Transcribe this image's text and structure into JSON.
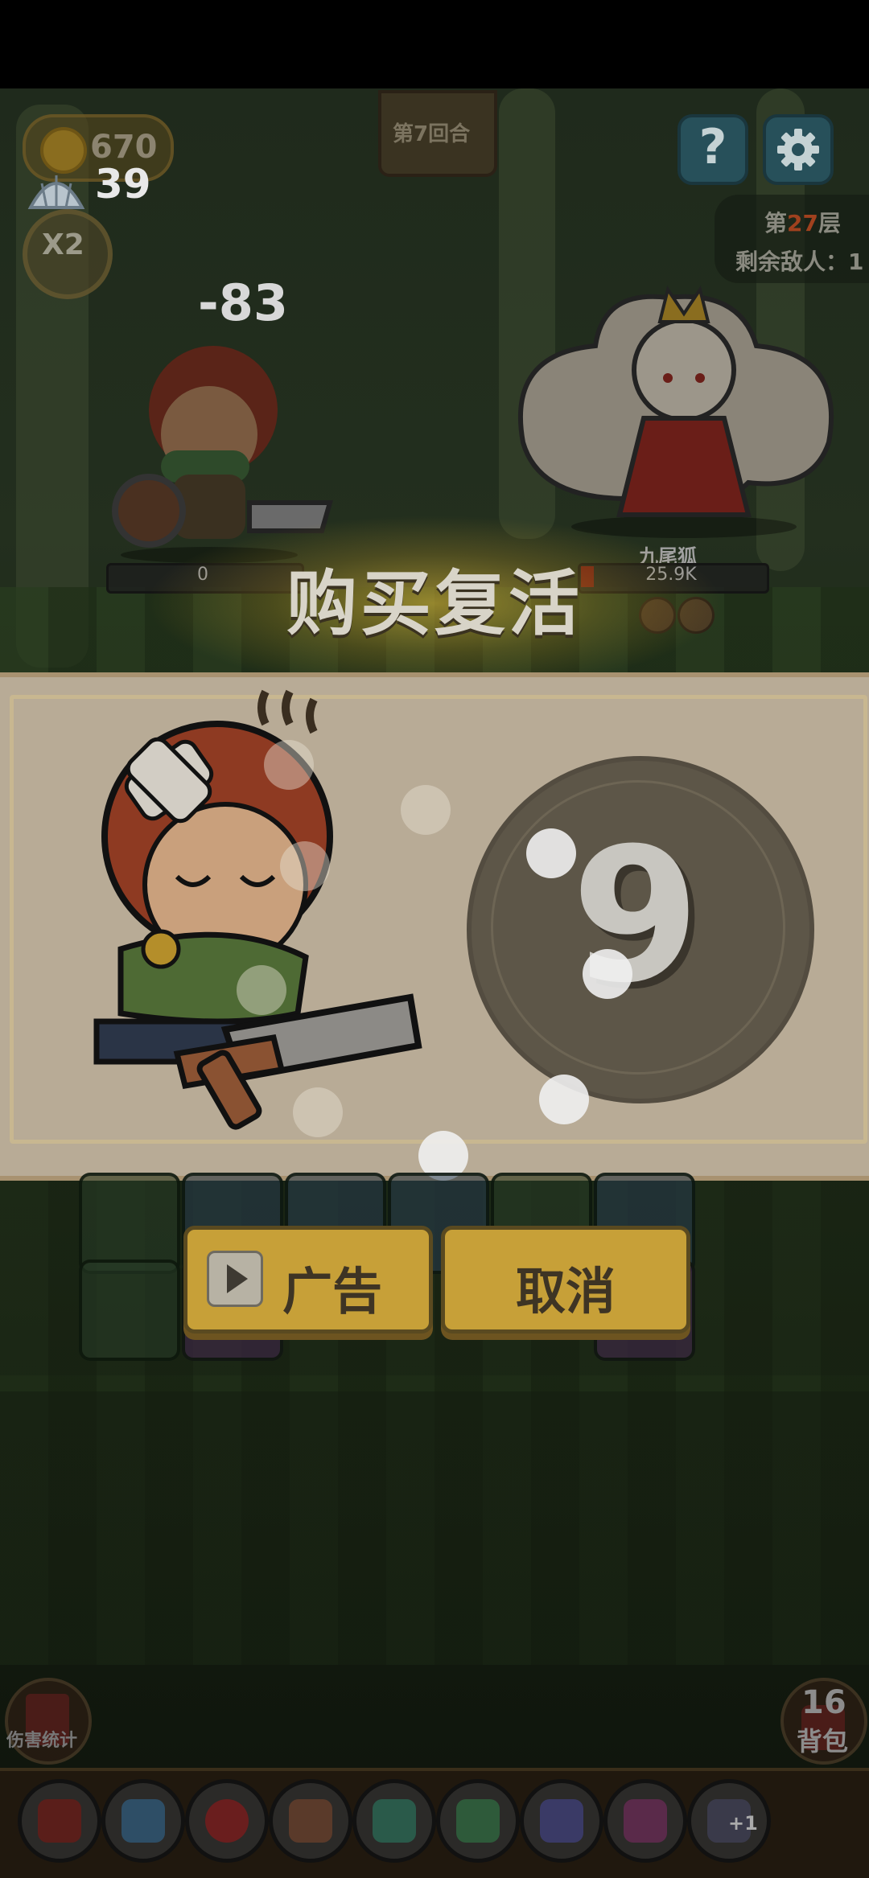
{
  "hud": {
    "coins": "670",
    "shells": "39",
    "speed": "X2",
    "round": "第7回合",
    "help_label": "?",
    "floor_prefix": "第",
    "floor_number": "27",
    "floor_suffix": "层",
    "enemies_remaining": "剩余敌人：1"
  },
  "battle": {
    "damage_popup": "-83",
    "hero_hp": "0",
    "enemy_name": "九尾狐",
    "enemy_hp": "25.9K"
  },
  "revive": {
    "title": "购买复活",
    "countdown": "9",
    "ad_button": "广告",
    "cancel_button": "取消"
  },
  "bottom": {
    "damage_stats": "伤害统计",
    "backpack_count": "16",
    "backpack_label": "背包",
    "toolbar_extra": "+1"
  },
  "colors": {
    "button": "#c7a038",
    "panel": "#b8ab96",
    "countdown_disc": "#5d5648",
    "help_button": "#27505a"
  },
  "icons": {
    "coin": "coin-icon",
    "shell": "shell-icon",
    "help": "question-icon",
    "settings": "gear-icon",
    "play": "play-icon"
  }
}
